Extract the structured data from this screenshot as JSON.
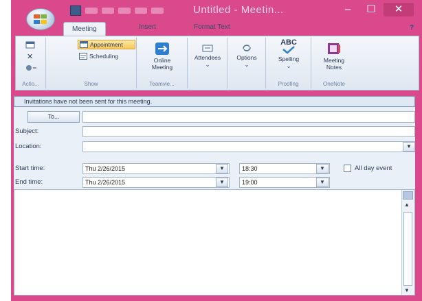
{
  "window": {
    "title": "Untitled - Meetin...",
    "minimize_glyph": "–",
    "maximize_glyph": "☐",
    "close_glyph": "✕",
    "accent": "#d9498c"
  },
  "tabs": [
    {
      "label": "Meeting",
      "active": true
    },
    {
      "label": "Insert",
      "active": false
    },
    {
      "label": "Format Text",
      "active": false
    }
  ],
  "help_glyph": "?",
  "ribbon": {
    "actions_label": "Actio...",
    "show": {
      "appointment_label": "Appointment",
      "scheduling_label": "Scheduling",
      "group_label": "Show"
    },
    "online": {
      "button_label_line1": "Online",
      "button_label_line2": "Meeting",
      "group_label": "Teamvie..."
    },
    "attendees_label": "Attendees",
    "options_label": "Options",
    "spelling": {
      "icon_text": "ABC",
      "label": "Spelling",
      "group_label": "Proofing"
    },
    "onenote": {
      "label_line1": "Meeting",
      "label_line2": "Notes",
      "group_label": "OneNote"
    }
  },
  "infobar": "Invitations have not been sent for this meeting.",
  "form": {
    "to_button": "To...",
    "subject_label": "Subject:",
    "location_label": "Location:",
    "start_label": "Start time:",
    "end_label": "End time:",
    "start_date": "Thu 2/26/2015",
    "start_time": "18:30",
    "end_date": "Thu 2/26/2015",
    "end_time": "19:00",
    "all_day_label": "All day event",
    "to_value": "",
    "subject_value": "",
    "location_value": ""
  }
}
